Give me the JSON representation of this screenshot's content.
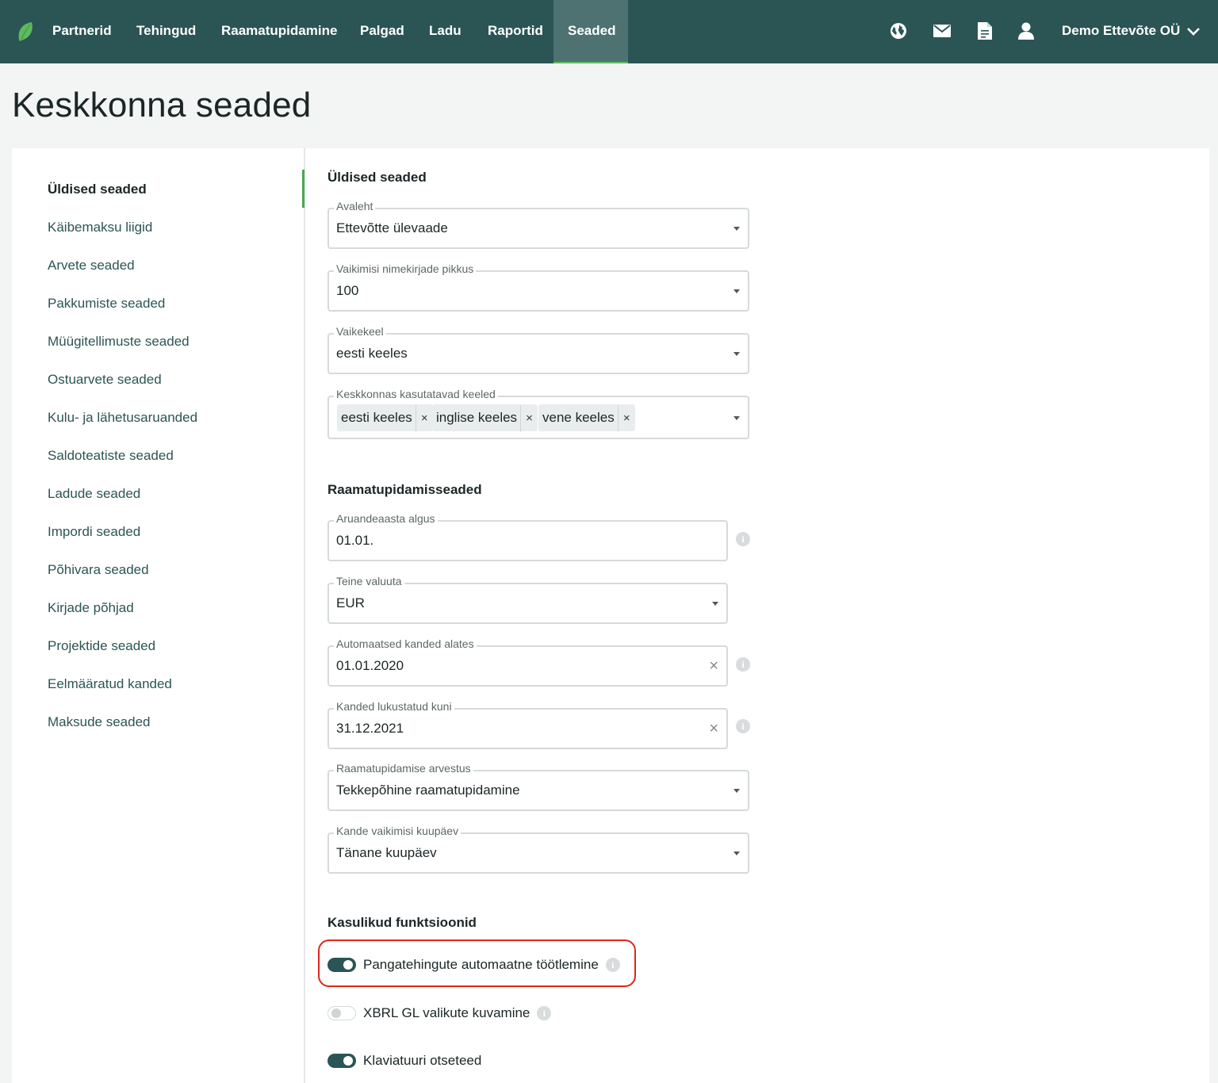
{
  "nav": {
    "items": [
      {
        "label": "Partnerid"
      },
      {
        "label": "Tehingud"
      },
      {
        "label": "Raamatupidamine"
      },
      {
        "label": "Palgad"
      },
      {
        "label": "Ladu"
      },
      {
        "label": "Raportid"
      },
      {
        "label": "Seaded",
        "active": true
      }
    ],
    "icons": [
      "globe-icon",
      "mail-icon",
      "document-icon",
      "user-icon"
    ],
    "company": "Demo Ettevõte OÜ",
    "colors": {
      "bar": "#2b5554",
      "active": "#4d7271",
      "accent": "#5dbb5d"
    }
  },
  "page": {
    "title": "Keskkonna seaded"
  },
  "sidebar": {
    "items": [
      {
        "label": "Üldised seaded",
        "active": true
      },
      {
        "label": "Käibemaksu liigid"
      },
      {
        "label": "Arvete seaded"
      },
      {
        "label": "Pakkumiste seaded"
      },
      {
        "label": "Müügitellimuste seaded"
      },
      {
        "label": "Ostuarvete seaded"
      },
      {
        "label": "Kulu- ja lähetusaruanded"
      },
      {
        "label": "Saldoteatiste seaded"
      },
      {
        "label": "Ladude seaded"
      },
      {
        "label": "Impordi seaded"
      },
      {
        "label": "Põhivara seaded"
      },
      {
        "label": "Kirjade põhjad"
      },
      {
        "label": "Projektide seaded"
      },
      {
        "label": "Eelmääratud kanded"
      },
      {
        "label": "Maksude seaded"
      }
    ]
  },
  "general": {
    "title": "Üldised seaded",
    "home": {
      "label": "Avaleht",
      "value": "Ettevõtte ülevaade"
    },
    "list_length": {
      "label": "Vaikimisi nimekirjade pikkus",
      "value": "100"
    },
    "default_language": {
      "label": "Vaikekeel",
      "value": "eesti keeles"
    },
    "languages": {
      "label": "Keskkonnas kasutatavad keeled",
      "chips": [
        "eesti keeles",
        "inglise keeles",
        "vene keeles"
      ],
      "remove": "×"
    }
  },
  "accounting": {
    "title": "Raamatupidamisseaded",
    "fiscal_start": {
      "label": "Aruandeaasta algus",
      "value": "01.01."
    },
    "second_currency": {
      "label": "Teine valuuta",
      "value": "EUR"
    },
    "auto_entries": {
      "label": "Automaatsed kanded alates",
      "value": "01.01.2020"
    },
    "locked_until": {
      "label": "Kanded lukustatud kuni",
      "value": "31.12.2021"
    },
    "method": {
      "label": "Raamatupidamise arvestus",
      "value": "Tekkepõhine raamatupidamine"
    },
    "default_date": {
      "label": "Kande vaikimisi kuupäev",
      "value": "Tänane kuupäev"
    },
    "clear": "×",
    "info": "i"
  },
  "features": {
    "title": "Kasulikud funktsioonid",
    "toggles": [
      {
        "label": "Pangatehingute automaatne töötlemine",
        "on": true
      },
      {
        "label": "XBRL GL valikute kuvamine",
        "on": false
      },
      {
        "label": "Klaviatuuri otseteed",
        "on": true
      }
    ]
  }
}
